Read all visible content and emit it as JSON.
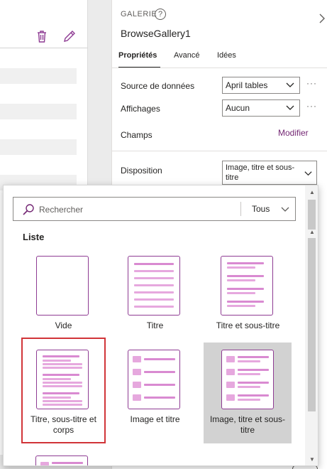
{
  "panel": {
    "control_type": "GALERIE",
    "control_name": "BrowseGallery1",
    "tabs": [
      "Propriétés",
      "Avancé",
      "Idées"
    ],
    "properties": {
      "data_source_label": "Source de données",
      "data_source_value": "April tables",
      "views_label": "Affichages",
      "views_value": "Aucun",
      "fields_label": "Champs",
      "fields_link": "Modifier",
      "layout_label": "Disposition",
      "layout_value": "Image, titre et sous-titre"
    },
    "ellipsis": "···"
  },
  "flyout": {
    "search_placeholder": "Rechercher",
    "filter_value": "Tous",
    "section_title": "Liste",
    "layouts": [
      {
        "label": "Vide"
      },
      {
        "label": "Titre"
      },
      {
        "label": "Titre et sous-titre"
      },
      {
        "label": "Titre, sous-titre et corps"
      },
      {
        "label": "Image et titre"
      },
      {
        "label": "Image, titre et sous-titre"
      }
    ]
  },
  "colors": {
    "accent": "#742774",
    "thumb_border": "#8e3b93",
    "thumb_fill": "#e6a8de",
    "highlight": "#d13438",
    "selected_bg": "#d2d2d2"
  }
}
